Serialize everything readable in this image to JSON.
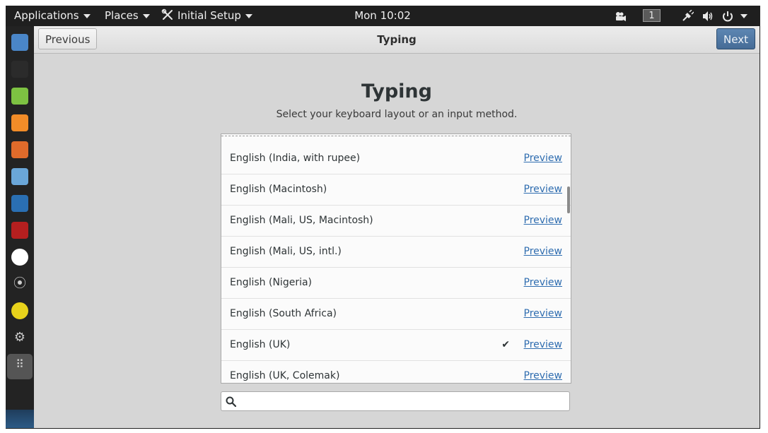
{
  "topbar": {
    "applications": "Applications",
    "places": "Places",
    "initial_setup": "Initial Setup",
    "clock": "Mon 10:02",
    "workspace": "1"
  },
  "dock": {
    "items": [
      {
        "name": "files-icon",
        "color": "#4a86c8"
      },
      {
        "name": "terminal-icon",
        "color": "#2b2b2b"
      },
      {
        "name": "text-editor-icon",
        "color": "#7dc242"
      },
      {
        "name": "burpsuite-icon",
        "color": "#f28c28"
      },
      {
        "name": "zap-icon",
        "color": "#e06b2b"
      },
      {
        "name": "eye-icon",
        "color": "#6aa6d8"
      },
      {
        "name": "metasploit-icon",
        "color": "#2a6fb3"
      },
      {
        "name": "cherry-icon",
        "color": "#b51f1f"
      },
      {
        "name": "maltego-icon",
        "color": "#ffffff"
      },
      {
        "name": "wireless-tower-icon",
        "color": "#cfcfcf"
      },
      {
        "name": "wifi-icon",
        "color": "#e8d21b"
      },
      {
        "name": "settings-icon",
        "color": "#c8c8c8"
      },
      {
        "name": "app-grid-icon",
        "color": "#cfcfcf"
      }
    ]
  },
  "header": {
    "previous": "Previous",
    "title": "Typing",
    "next": "Next"
  },
  "page": {
    "title": "Typing",
    "subtitle": "Select your keyboard layout or an input method."
  },
  "layouts": [
    {
      "label": "English (India, with rupee)",
      "preview": "Preview",
      "selected": false
    },
    {
      "label": "English (Macintosh)",
      "preview": "Preview",
      "selected": false
    },
    {
      "label": "English (Mali, US, Macintosh)",
      "preview": "Preview",
      "selected": false
    },
    {
      "label": "English (Mali, US, intl.)",
      "preview": "Preview",
      "selected": false
    },
    {
      "label": "English (Nigeria)",
      "preview": "Preview",
      "selected": false
    },
    {
      "label": "English (South Africa)",
      "preview": "Preview",
      "selected": false
    },
    {
      "label": "English (UK)",
      "preview": "Preview",
      "selected": true
    },
    {
      "label": "English (UK, Colemak)",
      "preview": "Preview",
      "selected": false
    }
  ],
  "check_glyph": "✔",
  "search": {
    "value": "",
    "placeholder": ""
  }
}
